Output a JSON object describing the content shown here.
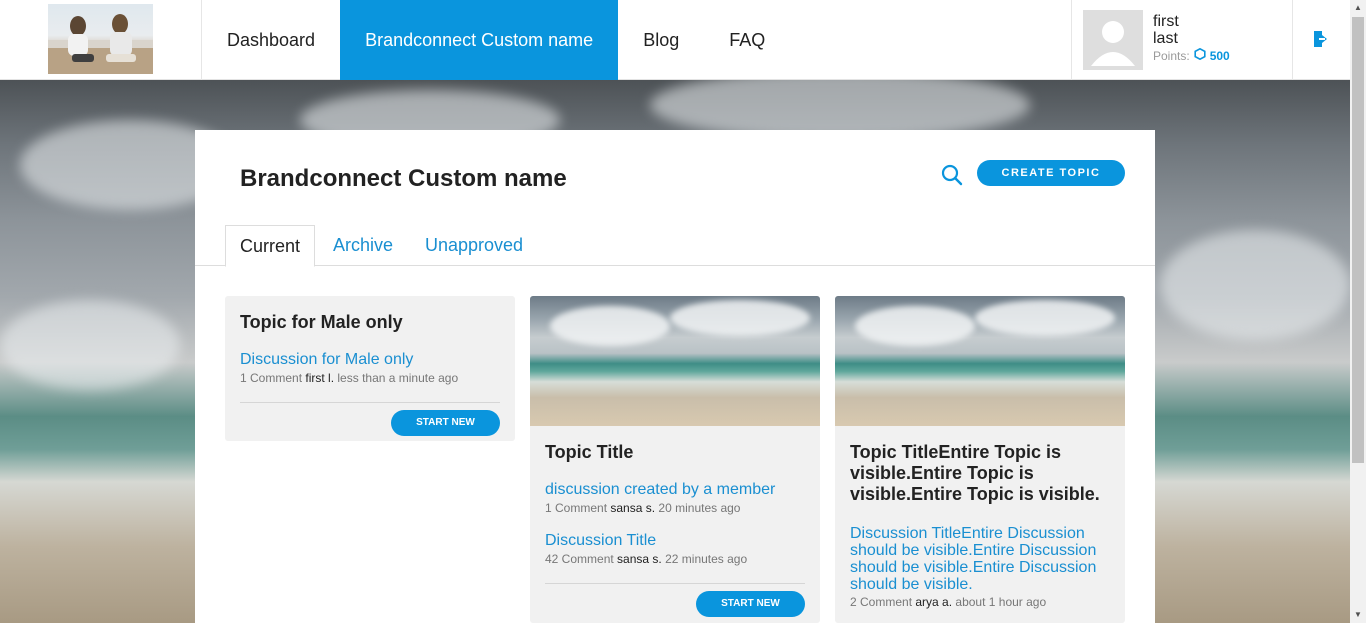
{
  "header": {
    "logo_alt": "brand logo photo",
    "nav": [
      {
        "label": "Dashboard",
        "active": false
      },
      {
        "label": "Brandconnect Custom name",
        "active": true
      },
      {
        "label": "Blog",
        "active": false
      },
      {
        "label": "FAQ",
        "active": false
      }
    ],
    "user": {
      "first": "first",
      "last": "last",
      "points_label": "Points:",
      "points_value": "500"
    }
  },
  "panel": {
    "title": "Brandconnect Custom name",
    "create_button": "CREATE TOPIC",
    "tabs": [
      {
        "label": "Current",
        "active": true
      },
      {
        "label": "Archive",
        "active": false
      },
      {
        "label": "Unapproved",
        "active": false
      }
    ]
  },
  "cards": [
    {
      "title": "Topic for Male only",
      "discussions": [
        {
          "title": "Discussion for Male only",
          "comments": "1 Comment",
          "author": "first l.",
          "time": "less than a minute ago"
        }
      ],
      "button": "START NEW"
    },
    {
      "title": "Topic Title",
      "discussions": [
        {
          "title": "discussion created by a member",
          "comments": "1 Comment",
          "author": "sansa s.",
          "time": "20 minutes ago"
        },
        {
          "title": "Discussion Title",
          "comments": "42 Comment",
          "author": "sansa s.",
          "time": "22 minutes ago"
        }
      ],
      "button": "START NEW"
    },
    {
      "title": "Topic TitleEntire Topic is visible.Entire Topic is visible.Entire Topic is visible.",
      "discussions": [
        {
          "title": "Discussion TitleEntire Discussion should be visible.Entire Discussion should be visible.Entire Discussion should be visible.",
          "comments": "2 Comment",
          "author": "arya a.",
          "time": "about 1 hour ago"
        }
      ]
    }
  ],
  "colors": {
    "accent": "#0a95dd",
    "link": "#1a8fd1"
  }
}
